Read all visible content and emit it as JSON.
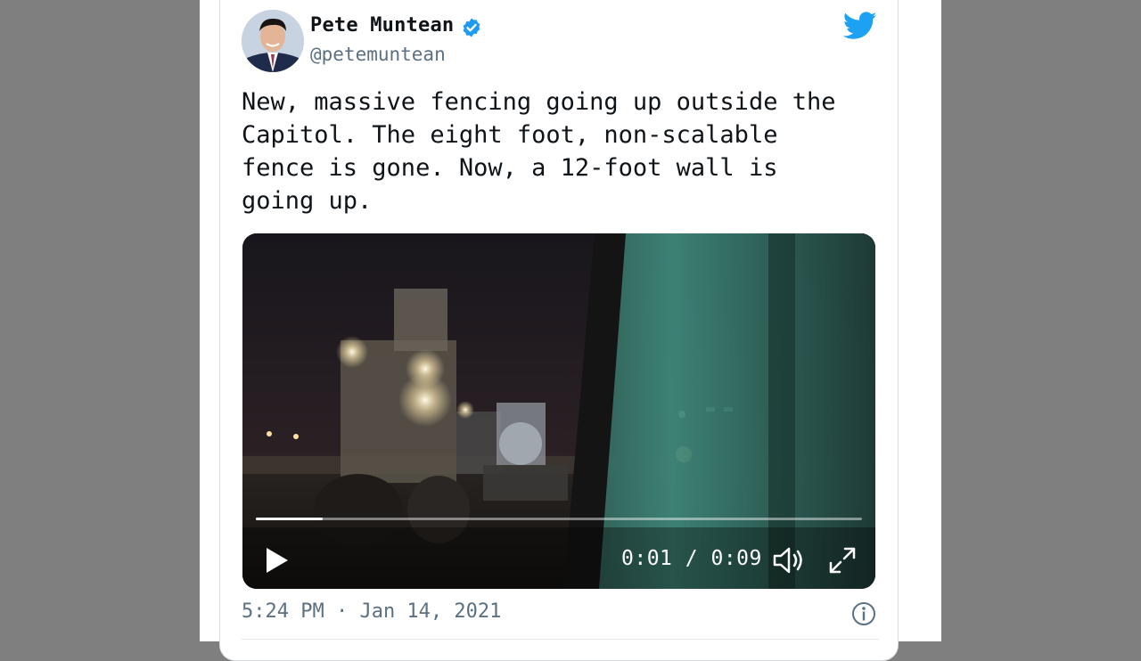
{
  "tweet": {
    "author_name": "Pete Muntean",
    "author_handle": "@petemuntean",
    "text": "New, massive fencing going up outside the\nCapitol. The eight foot, non-scalable\nfence is gone. Now, a 12-foot wall is\ngoing up.",
    "timestamp": "5:24 PM · Jan 14, 2021"
  },
  "icons": {
    "verified": "verified-badge-icon",
    "brand": "twitter-bird-icon",
    "play": "play-icon",
    "volume": "volume-icon",
    "fullscreen": "fullscreen-icon",
    "info": "info-icon"
  },
  "video": {
    "current_time": "0:01",
    "separator": "/",
    "duration": "0:09",
    "progress": 0.11
  },
  "colors": {
    "brand_blue": "#1da1f2",
    "verified_blue": "#1d9bf0",
    "muted_text": "#5b7083"
  }
}
